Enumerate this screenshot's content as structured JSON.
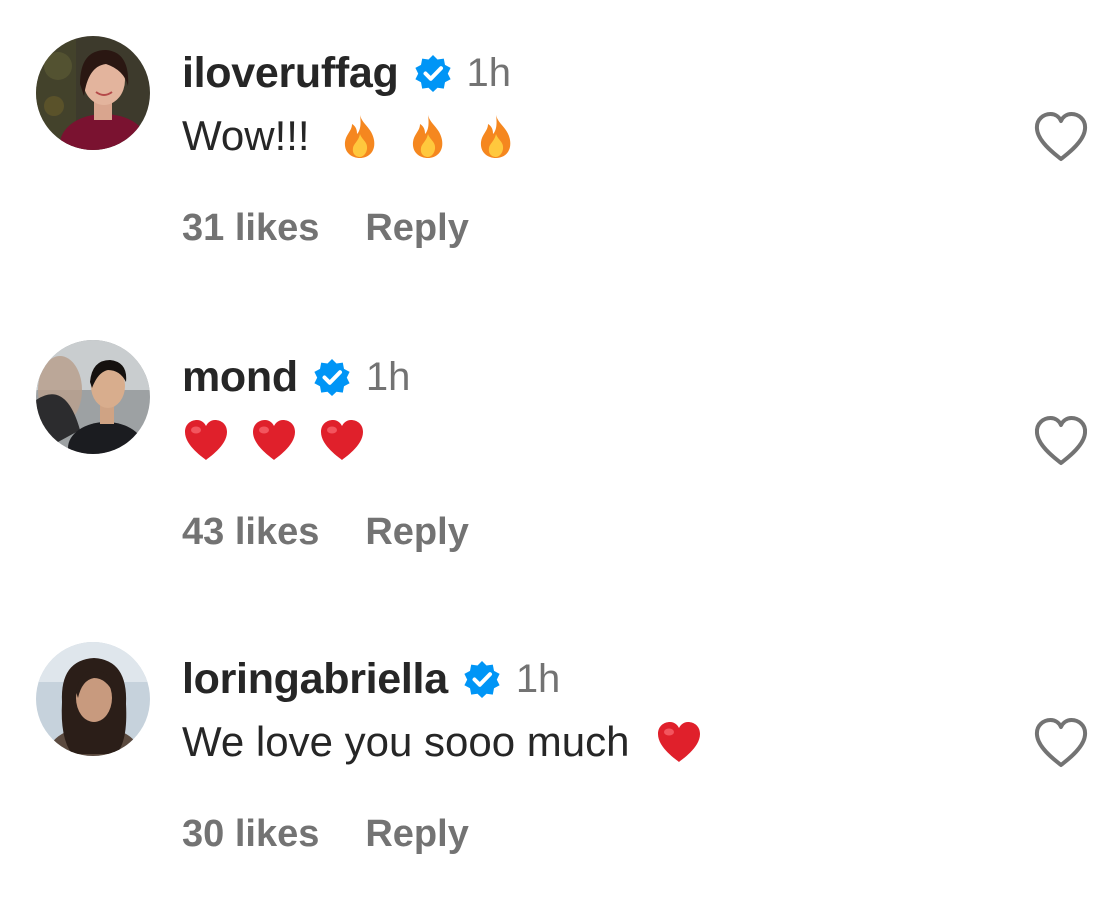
{
  "comments": [
    {
      "username": "iloveruffag",
      "verified": true,
      "time": "1h",
      "text": "Wow!!!",
      "emojis": [
        "fire-emoji",
        "fire-emoji",
        "fire-emoji"
      ],
      "likes": "31 likes",
      "reply_label": "Reply"
    },
    {
      "username": "mond",
      "verified": true,
      "time": "1h",
      "text": "",
      "emojis": [
        "red-heart-emoji",
        "red-heart-emoji",
        "red-heart-emoji"
      ],
      "likes": "43 likes",
      "reply_label": "Reply"
    },
    {
      "username": "loringabriella",
      "verified": true,
      "time": "1h",
      "text": "We love you sooo much",
      "emojis": [
        "red-heart-emoji"
      ],
      "likes": "30 likes",
      "reply_label": "Reply"
    }
  ],
  "icons": {
    "verified": "verified-badge-icon",
    "like": "heart-outline-icon"
  },
  "colors": {
    "text_primary": "#262626",
    "text_secondary": "#737373",
    "verified_blue": "#0095f6",
    "heart_red": "#e0202b",
    "fire_orange": "#f5871f"
  }
}
